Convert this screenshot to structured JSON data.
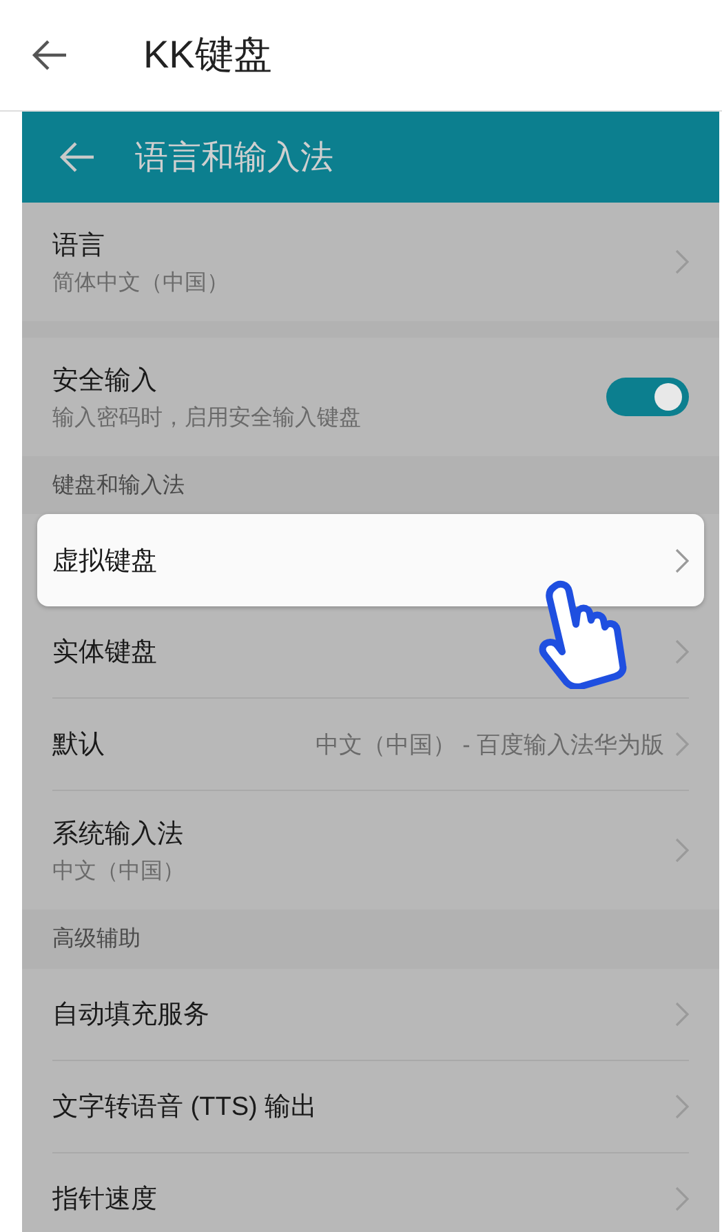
{
  "app_bar": {
    "title": "KK键盘"
  },
  "panel": {
    "title": "语言和输入法",
    "items": [
      {
        "kind": "nav",
        "title": "语言",
        "subtitle": "简体中文（中国）",
        "highlighted": false
      },
      {
        "kind": "gap"
      },
      {
        "kind": "toggle",
        "title": "安全输入",
        "subtitle": "输入密码时，启用安全输入键盘",
        "on": true
      },
      {
        "kind": "header",
        "title": "键盘和输入法"
      },
      {
        "kind": "nav",
        "title": "虚拟键盘",
        "highlighted": true
      },
      {
        "kind": "nav",
        "title": "实体键盘",
        "highlighted": false
      },
      {
        "kind": "nav",
        "title": "默认",
        "value": "中文（中国） - 百度输入法华为版",
        "highlighted": false
      },
      {
        "kind": "nav",
        "title": "系统输入法",
        "subtitle": "中文（中国）",
        "highlighted": false
      },
      {
        "kind": "header",
        "title": "高级辅助"
      },
      {
        "kind": "nav",
        "title": "自动填充服务",
        "highlighted": false
      },
      {
        "kind": "nav",
        "title": "文字转语音 (TTS) 输出",
        "highlighted": false
      },
      {
        "kind": "nav",
        "title": "指针速度",
        "highlighted": false
      }
    ]
  }
}
